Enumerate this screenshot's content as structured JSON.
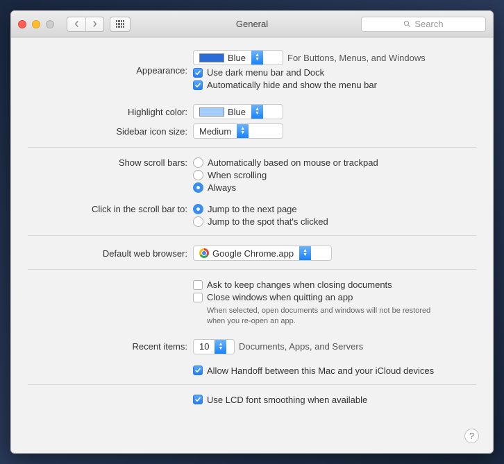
{
  "window": {
    "title": "General",
    "search_placeholder": "Search"
  },
  "appearance": {
    "label": "Appearance:",
    "value": "Blue",
    "hint": "For Buttons, Menus, and Windows",
    "dark_menu": "Use dark menu bar and Dock",
    "auto_hide": "Automatically hide and show the menu bar"
  },
  "highlight": {
    "label": "Highlight color:",
    "value": "Blue"
  },
  "sidebar": {
    "label": "Sidebar icon size:",
    "value": "Medium"
  },
  "scrollbars": {
    "label": "Show scroll bars:",
    "opt_auto": "Automatically based on mouse or trackpad",
    "opt_scrolling": "When scrolling",
    "opt_always": "Always"
  },
  "click_scroll": {
    "label": "Click in the scroll bar to:",
    "opt_next": "Jump to the next page",
    "opt_spot": "Jump to the spot that's clicked"
  },
  "browser": {
    "label": "Default web browser:",
    "value": "Google Chrome.app"
  },
  "documents": {
    "ask_keep": "Ask to keep changes when closing documents",
    "close_quit": "Close windows when quitting an app",
    "close_quit_hint": "When selected, open documents and windows will not be restored when you re-open an app."
  },
  "recent": {
    "label": "Recent items:",
    "value": "10",
    "hint": "Documents, Apps, and Servers"
  },
  "handoff": {
    "label": "Allow Handoff between this Mac and your iCloud devices"
  },
  "lcd": {
    "label": "Use LCD font smoothing when available"
  },
  "help": "?"
}
